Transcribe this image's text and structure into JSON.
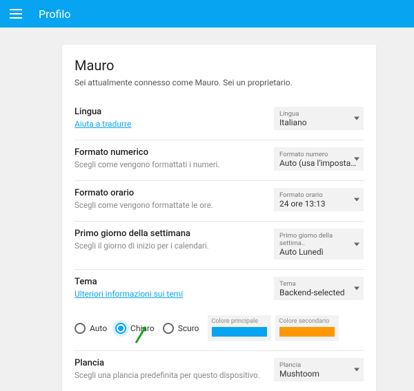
{
  "header": {
    "title": "Profilo"
  },
  "profile": {
    "name": "Mauro",
    "subtitle": "Sei attualmente connesso come Mauro. Sei un proprietario."
  },
  "settings": {
    "language": {
      "title": "Lingua",
      "help_link": "Aiuta a tradurre",
      "select_label": "Lingua",
      "select_value": "Italiano"
    },
    "number_format": {
      "title": "Formato numerico",
      "desc": "Scegli come vengono formattati i numeri.",
      "select_label": "Formato numero",
      "select_value": "Auto (usa l'impostazio"
    },
    "time_format": {
      "title": "Formato orario",
      "desc": "Scegli come vengono formattate le ore.",
      "select_label": "Formato orario",
      "select_value": "24 ore 13:13"
    },
    "first_day": {
      "title": "Primo giorno della settimana",
      "desc": "Scegli il giorno di inizio per i calendari.",
      "select_label": "Primo giorno della settima..",
      "select_value": "Auto Lunedì"
    },
    "theme": {
      "title": "Tema",
      "help_link": "Ulteriori informazioni sui temi",
      "select_label": "Tema",
      "select_value": "Backend-selected",
      "radio_auto": "Auto",
      "radio_light": "Chiaro",
      "radio_dark": "Scuro",
      "primary_label": "Colore principale",
      "primary_color": "#07a5f1",
      "secondary_label": "Colore secondario",
      "secondary_color": "#ff9800"
    },
    "dashboard": {
      "title": "Plancia",
      "desc": "Scegli una plancia predefinita per questo dispositivo.",
      "select_label": "Plancia",
      "select_value": "Mushtoom"
    }
  }
}
